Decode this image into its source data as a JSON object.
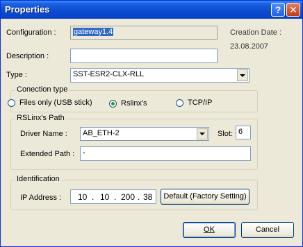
{
  "window": {
    "title": "Properties",
    "help_glyph": "?",
    "close_glyph": "✕"
  },
  "form": {
    "configuration_label": "Configuration :",
    "configuration_value": "gateway1.4",
    "creation_date_label": "Creation Date :",
    "creation_date_value": "23.08.2007",
    "description_label": "Description :",
    "description_value": "",
    "type_label": "Type :",
    "type_value": "SST-ESR2-CLX-RLL"
  },
  "connection": {
    "group_title": "Conection type",
    "options": [
      "Files only (USB stick)",
      "Rslinx's",
      "TCP/IP"
    ],
    "selected": "Rslinx's"
  },
  "rslinx": {
    "group_title": "RSLinx's Path",
    "driver_label": "Driver Name :",
    "driver_value": "AB_ETH-2",
    "slot_label": "Slot:",
    "slot_value": "6",
    "extended_label": "Extended Path :",
    "extended_value": "-"
  },
  "identification": {
    "group_title": "Identification",
    "ip_label": "IP Address :",
    "ip_octets": [
      "10",
      "10",
      "200",
      "38"
    ],
    "ip_dot": ".",
    "default_button": "Default (Factory Setting)"
  },
  "buttons": {
    "ok": "OK",
    "cancel": "Cancel"
  }
}
